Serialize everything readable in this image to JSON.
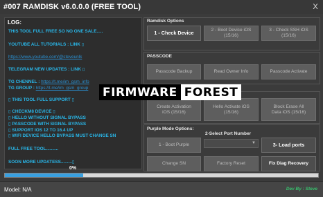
{
  "window": {
    "title": "#007 RAMDISK v6.0.0.0 (FREE TOOL)",
    "close_label": "X"
  },
  "log": {
    "title": "LOG:",
    "lines": [
      "THIS TOOL FULL FREE SO NO ONE SALE.....",
      "YOUTUBE ALL TUTORIALS : LINK ▯",
      "https://www.youtube.com/@steveunlk",
      "TELEGRAM NEW UPDATES : LINK ▯",
      "TG CHENNEL :",
      "TG GROUP :",
      "▯ THIS TOOL FULL SUPPORT ▯",
      "▯ CHECKM8 DEVICE ▯",
      "▯ HELLO WITHOUT SIGNAL BYPASS",
      "▯ PASSCODE WITH SIGNAL BYPASS",
      "▯ SUPPORT IOS 12 TO 16.4 UP",
      "▯ WIFI DEVICE HELLO BYPASS MUST CHANGE SN",
      "FULL FREE TOOL..........",
      "SOON MORE UPDATESS.........▯"
    ],
    "tg_channel_link": "https://t.me/im_gsm_info",
    "tg_group_link": "https://t.me/im_gsm_group"
  },
  "ramdisk": {
    "label": "Ramdisk Options",
    "check_device": "1 - Check Device",
    "boot_device": "2 - Boot Device iOS\n(15/16)",
    "check_ssh": "3 - Check SSH iOS\n(15/16)"
  },
  "passcode": {
    "label": "PASSCODE",
    "backup": "Passcode Backup",
    "read_owner": "Read Owner Info",
    "activate": "Passcode Activate"
  },
  "hello": {
    "create_activation": "Create Activation\niOS (15/16)",
    "hello_activate": "Hello Activate iOS\n(15/16)",
    "block_erase": "Block Erase All\nData iOS (15/16)"
  },
  "purple": {
    "label": "Purple Mode Options:",
    "port_label": "2-Select Port Number",
    "boot_purple": "1 - Boot Purple",
    "load_ports": "3- Load ports",
    "change_sn": "Change SN",
    "factory_reset": "Factory Reset",
    "fix_diag": "Fix Diag Recovery"
  },
  "progress": {
    "text": "0%",
    "value": 0.25
  },
  "status": {
    "model_label": "Model: N/A",
    "developer": "Dev By : Steve"
  },
  "watermark": {
    "part1": "FIRMWARE",
    "part2": "FOREST"
  },
  "colors": {
    "log_text": "#29b6e8",
    "developer": "#38c26e",
    "progress_fill": "#39a0e0"
  }
}
